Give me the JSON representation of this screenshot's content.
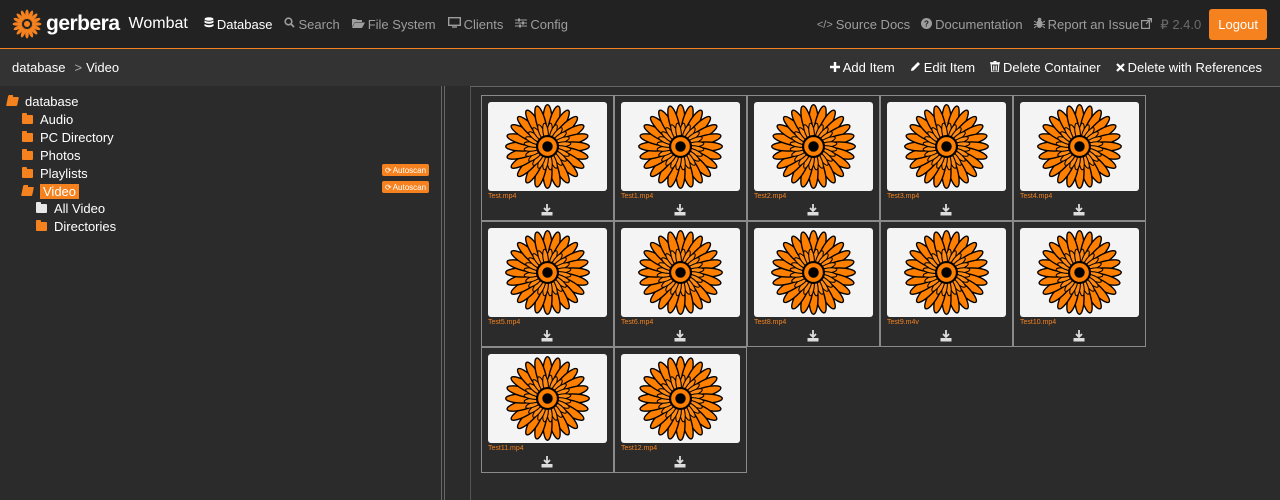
{
  "navbar": {
    "brand": "gerbera",
    "brand_sub": "Wombat",
    "items": [
      {
        "label": "Database",
        "icon": "database-icon",
        "active": true
      },
      {
        "label": "Search",
        "icon": "search-icon"
      },
      {
        "label": "File System",
        "icon": "folder-open-icon"
      },
      {
        "label": "Clients",
        "icon": "monitor-icon"
      },
      {
        "label": "Config",
        "icon": "sliders-icon"
      }
    ],
    "right_items": [
      {
        "label": "Source Docs",
        "icon": "code-icon"
      },
      {
        "label": "Documentation",
        "icon": "question-circle-icon"
      },
      {
        "label": "Report an Issue",
        "icon": "bug-icon"
      }
    ],
    "version": "2.4.0",
    "logout": "Logout"
  },
  "breadcrumb": {
    "root": "database",
    "separator": ">",
    "current": "Video"
  },
  "actions": [
    {
      "label": "Add Item",
      "icon": "plus-icon"
    },
    {
      "label": "Edit Item",
      "icon": "pencil-icon"
    },
    {
      "label": "Delete Container",
      "icon": "trash-icon"
    },
    {
      "label": "Delete with References",
      "icon": "times-icon"
    }
  ],
  "tree": {
    "root": "database",
    "items": [
      {
        "label": "Audio"
      },
      {
        "label": "PC Directory"
      },
      {
        "label": "Photos"
      },
      {
        "label": "Playlists",
        "autoscan": "Autoscan"
      },
      {
        "label": "Video",
        "autoscan": "Autoscan",
        "selected": true
      },
      {
        "label": "All Video"
      },
      {
        "label": "Directories"
      }
    ]
  },
  "items": [
    {
      "name": "Test.mp4"
    },
    {
      "name": "Test1.mp4"
    },
    {
      "name": "Test2.mp4"
    },
    {
      "name": "Test3.mp4"
    },
    {
      "name": "Test4.mp4"
    },
    {
      "name": "Test5.mp4"
    },
    {
      "name": "Test6.mp4"
    },
    {
      "name": "Test8.mp4"
    },
    {
      "name": "Test9.m4v"
    },
    {
      "name": "Test10.mp4"
    },
    {
      "name": "Test11.mp4"
    },
    {
      "name": "Test12.mp4"
    }
  ],
  "colors": {
    "accent": "#f5821f",
    "navbar": "#222222",
    "background": "#2b2b2b"
  }
}
